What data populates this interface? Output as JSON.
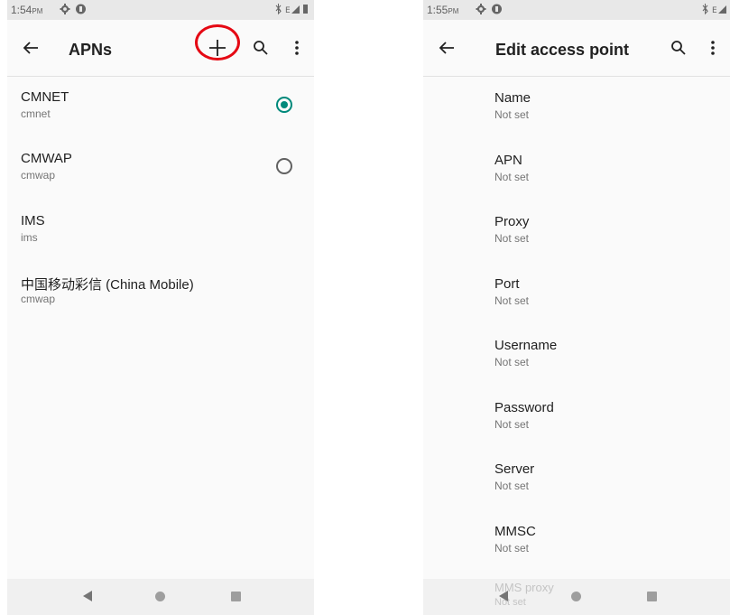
{
  "left_screen": {
    "status": {
      "time": "1:54",
      "ampm": "PM"
    },
    "app_bar": {
      "title": "APNs",
      "actions": [
        "add-icon",
        "search-icon",
        "overflow-menu-icon"
      ]
    },
    "apn_list": [
      {
        "name": "CMNET",
        "apn": "cmnet",
        "selected": true
      },
      {
        "name": "CMWAP",
        "apn": "cmwap",
        "selected": false
      },
      {
        "name": "IMS",
        "apn": "ims"
      },
      {
        "name": "中国移动彩信 (China Mobile)",
        "apn": "cmwap"
      }
    ]
  },
  "right_screen": {
    "status": {
      "time": "1:55",
      "ampm": "PM"
    },
    "app_bar": {
      "title": "Edit access point",
      "actions": [
        "search-icon",
        "overflow-menu-icon"
      ]
    },
    "fields": [
      {
        "label": "Name",
        "value": "Not set"
      },
      {
        "label": "APN",
        "value": "Not set"
      },
      {
        "label": "Proxy",
        "value": "Not set"
      },
      {
        "label": "Port",
        "value": "Not set"
      },
      {
        "label": "Username",
        "value": "Not set"
      },
      {
        "label": "Password",
        "value": "Not set"
      },
      {
        "label": "Server",
        "value": "Not set"
      },
      {
        "label": "MMSC",
        "value": "Not set"
      }
    ],
    "partial_field": {
      "label": "MMS proxy",
      "value": "Not set"
    }
  },
  "annotation": {
    "color": "#e50914",
    "target": "add-icon"
  },
  "colors": {
    "accent": "#00897b"
  }
}
